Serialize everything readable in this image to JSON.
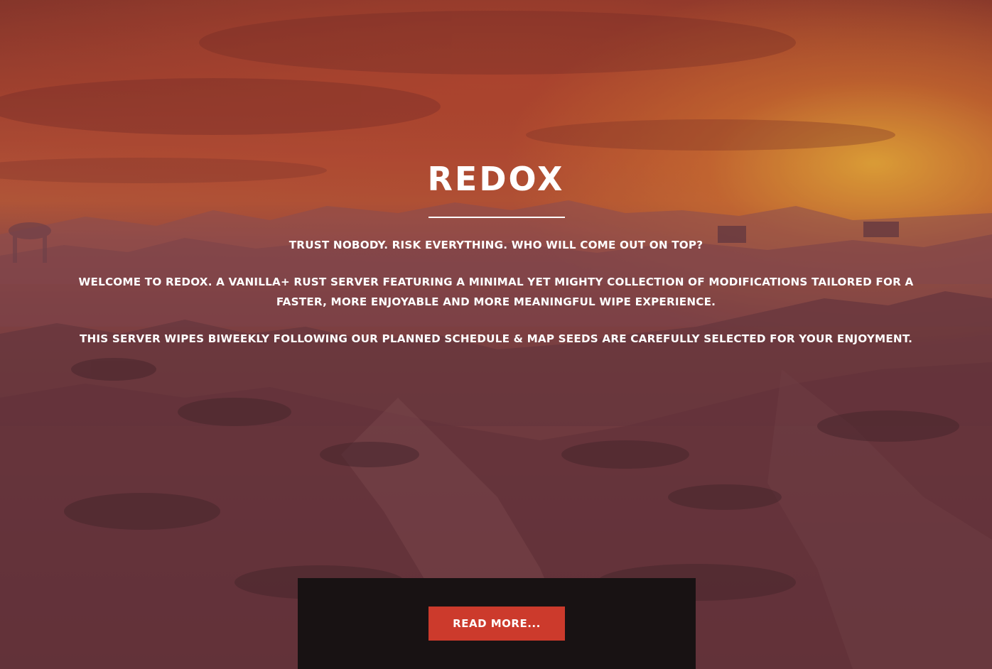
{
  "hero": {
    "title": "REDOX",
    "tagline": "TRUST NOBODY. RISK EVERYTHING. WHO WILL COME OUT ON TOP?",
    "paragraphs": [
      "WELCOME TO REDOX. A VANILLA+ RUST SERVER FEATURING A MINIMAL YET MIGHTY COLLECTION OF MODIFICATIONS TAILORED FOR A FASTER, MORE ENJOYABLE AND MORE MEANINGFUL WIPE EXPERIENCE.",
      "THIS SERVER WIPES BIWEEKLY FOLLOWING OUR PLANNED SCHEDULE & MAP SEEDS ARE CAREFULLY SELECTED FOR YOUR ENJOYMENT."
    ]
  },
  "cta": {
    "read_more_label": "READ MORE..."
  },
  "colors": {
    "accent_button": "#cc3a2c",
    "panel_bg": "#181213",
    "text": "#ffffff"
  }
}
